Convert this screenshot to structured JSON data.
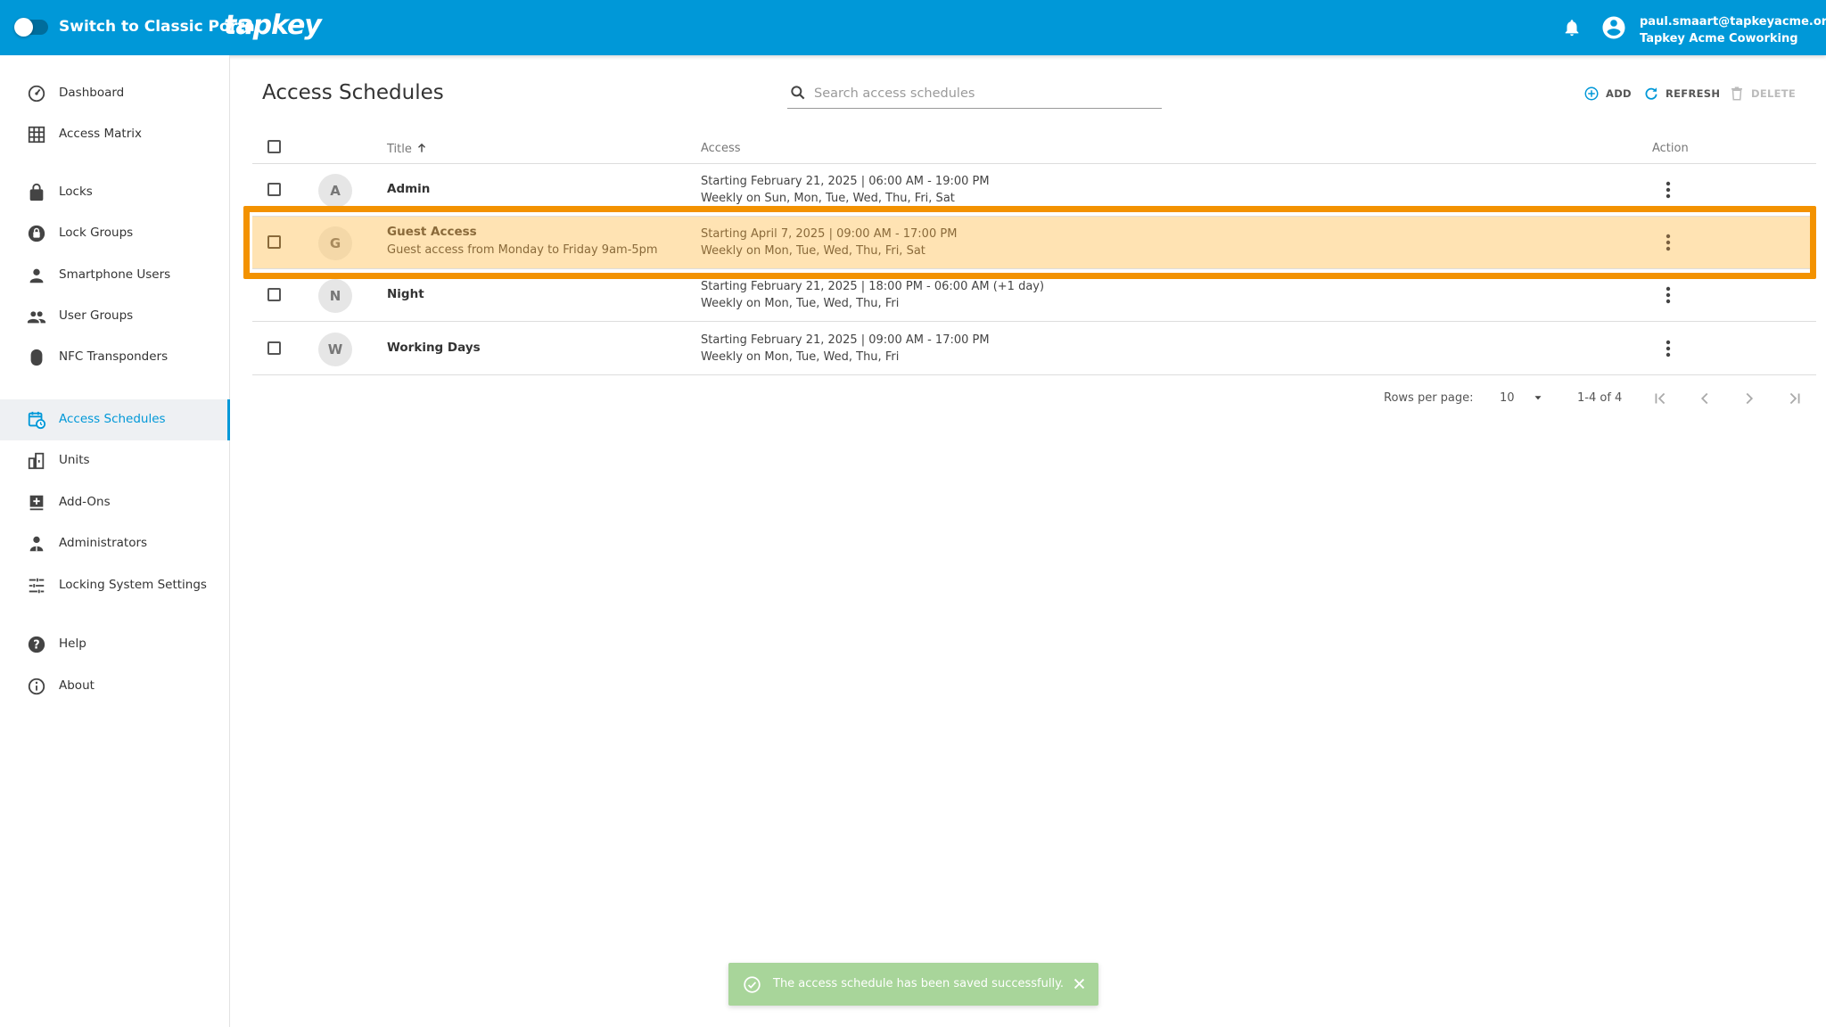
{
  "header": {
    "switch_label": "Switch to Classic Portal",
    "logo": "tapkey",
    "user_email": "paul.smaart@tapkeyacme.org",
    "org_name": "Tapkey Acme Coworking"
  },
  "sidebar": {
    "items": [
      {
        "label": "Dashboard",
        "icon": "dashboard-icon"
      },
      {
        "label": "Access Matrix",
        "icon": "grid-icon"
      },
      {
        "label": "Locks",
        "icon": "lock-icon"
      },
      {
        "label": "Lock Groups",
        "icon": "lock-group-icon"
      },
      {
        "label": "Smartphone Users",
        "icon": "person-icon"
      },
      {
        "label": "User Groups",
        "icon": "people-icon"
      },
      {
        "label": "NFC Transponders",
        "icon": "transponder-icon"
      },
      {
        "label": "Access Schedules",
        "icon": "calendar-clock-icon"
      },
      {
        "label": "Units",
        "icon": "units-icon"
      },
      {
        "label": "Add-Ons",
        "icon": "add-on-icon"
      },
      {
        "label": "Administrators",
        "icon": "admin-icon"
      },
      {
        "label": "Locking System Settings",
        "icon": "tune-icon"
      },
      {
        "label": "Help",
        "icon": "help-icon"
      },
      {
        "label": "About",
        "icon": "info-icon"
      }
    ]
  },
  "main": {
    "title": "Access Schedules",
    "search_placeholder": "Search access schedules",
    "toolbar": {
      "add": "ADD",
      "refresh": "REFRESH",
      "delete": "DELETE"
    },
    "columns": {
      "title": "Title",
      "access": "Access",
      "action": "Action"
    },
    "rows": [
      {
        "initial": "A",
        "title": "Admin",
        "subtitle": "",
        "access_line1": "Starting February 21, 2025 | 06:00 AM - 19:00 PM",
        "access_line2": "Weekly on Sun, Mon, Tue, Wed, Thu, Fri, Sat"
      },
      {
        "initial": "G",
        "title": "Guest Access",
        "subtitle": "Guest access from Monday to Friday 9am-5pm",
        "access_line1": "Starting April 7, 2025 | 09:00 AM - 17:00 PM",
        "access_line2": "Weekly on Mon, Tue, Wed, Thu, Fri, Sat"
      },
      {
        "initial": "N",
        "title": "Night",
        "subtitle": "",
        "access_line1": "Starting February 21, 2025 | 18:00 PM - 06:00 AM (+1 day)",
        "access_line2": "Weekly on Mon, Tue, Wed, Thu, Fri"
      },
      {
        "initial": "W",
        "title": "Working Days",
        "subtitle": "",
        "access_line1": "Starting February 21, 2025 | 09:00 AM - 17:00 PM",
        "access_line2": "Weekly on Mon, Tue, Wed, Thu, Fri"
      }
    ],
    "pagination": {
      "rows_label": "Rows per page:",
      "rows_value": "10",
      "range": "1-4 of 4"
    }
  },
  "toast": {
    "message": "The access schedule has been saved successfully."
  },
  "colors": {
    "brand": "#0098d8",
    "highlight": "#f39200",
    "selected_row": "#ffe3b3",
    "toast": "#a8d59a"
  }
}
